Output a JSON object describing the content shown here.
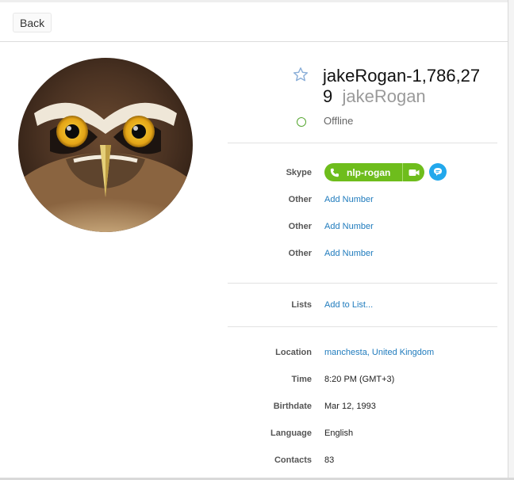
{
  "toolbar": {
    "back_label": "Back"
  },
  "profile": {
    "display_name": "jakeRogan-1,786,27",
    "display_name_wrap": "9",
    "username": "jakeRogan",
    "status": "Offline"
  },
  "contact_rows": [
    {
      "label": "Skype",
      "skype_id": "nlp-rogan"
    },
    {
      "label": "Other",
      "value": "Add Number"
    },
    {
      "label": "Other",
      "value": "Add Number"
    },
    {
      "label": "Other",
      "value": "Add Number"
    }
  ],
  "lists": {
    "label": "Lists",
    "value": "Add to List..."
  },
  "details": [
    {
      "label": "Location",
      "value": "manchesta, United Kingdom"
    },
    {
      "label": "Time",
      "value": "8:20 PM (GMT+3)"
    },
    {
      "label": "Birthdate",
      "value": "Mar 12, 1993"
    },
    {
      "label": "Language",
      "value": "English"
    },
    {
      "label": "Contacts",
      "value": "83"
    }
  ],
  "colors": {
    "skype_green": "#6ebd1c",
    "chat_blue": "#22a8ec",
    "link_blue": "#1f7bbd",
    "status_green": "#55a630"
  },
  "icons": [
    "star-icon",
    "offline-status-icon",
    "phone-icon",
    "video-icon",
    "chat-icon"
  ]
}
